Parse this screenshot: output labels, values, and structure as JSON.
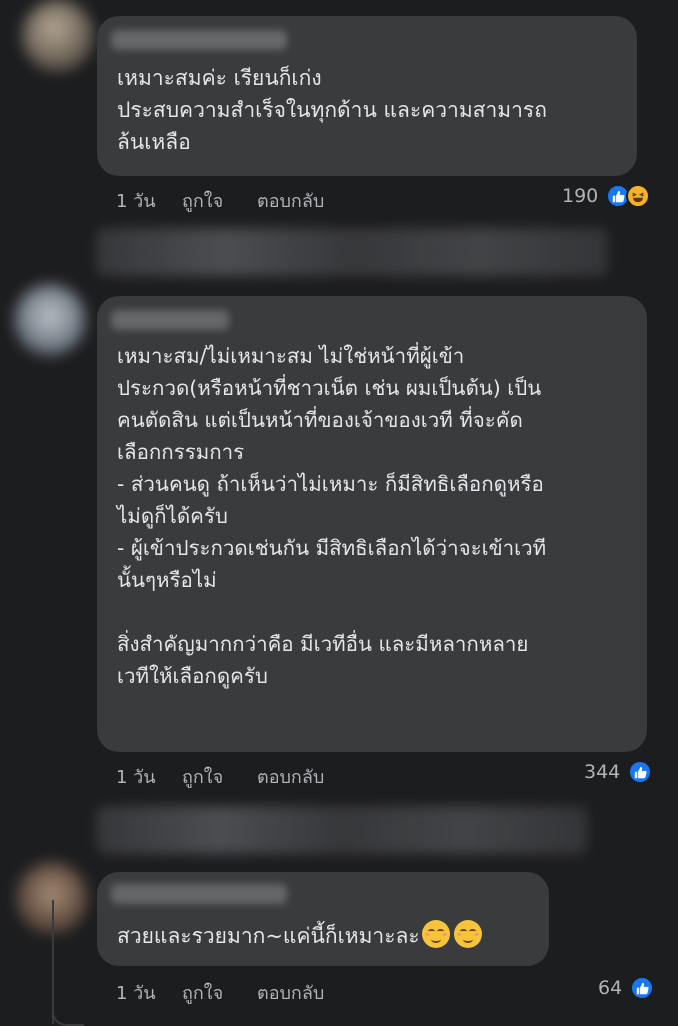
{
  "comments": [
    {
      "text": "เหมาะสมค่ะ เรียนก็เก่ง\nประสบความสำเร็จในทุกด้าน และความสามารถ\nล้นเหลือ",
      "time": "1 วัน",
      "like_label": "ถูกใจ",
      "reply_label": "ตอบกลับ",
      "reaction_count": "190",
      "reactions": [
        "like-icon",
        "haha-icon"
      ]
    },
    {
      "text": "เหมาะสม/ไม่เหมาะสม ไม่ใช่หน้าที่ผู้เข้า\nประกวด(หรือหน้าที่ชาวเน็ต เช่น ผมเป็นต้น) เป็น\nคนตัดสิน แต่เป็นหน้าที่ของเจ้าของเวที ที่จะคัด\nเลือกกรรมการ\n- ส่วนคนดู ถ้าเห็นว่าไม่เหมาะ ก็มีสิทธิเลือกดูหรือ\nไม่ดูก็ได้ครับ\n- ผู้เข้าประกวดเช่นกัน มีสิทธิเลือกได้ว่าจะเข้าเวที\nนั้นๆหรือไม่\n\nสิ่งสำคัญมากกว่าคือ มีเวทีอื่น และมีหลากหลาย\nเวทีให้เลือกดูครับ",
      "time": "1 วัน",
      "like_label": "ถูกใจ",
      "reply_label": "ตอบกลับ",
      "reaction_count": "344",
      "reactions": [
        "like-icon"
      ]
    },
    {
      "text": "สวยและรวยมาก~แค่นี้ก็เหมาะละ",
      "time": "1 วัน",
      "like_label": "ถูกใจ",
      "reply_label": "ตอบกลับ",
      "reaction_count": "64",
      "reactions": [
        "like-icon"
      ],
      "emojis": [
        "smiling-face-icon",
        "smiling-face-icon"
      ]
    }
  ],
  "colors": {
    "background": "#1c1d1f",
    "bubble": "#3a3b3c",
    "text": "#e4e6eb",
    "meta": "#b0b3b8",
    "like": "#1877f2",
    "haha": "#f7b125"
  }
}
